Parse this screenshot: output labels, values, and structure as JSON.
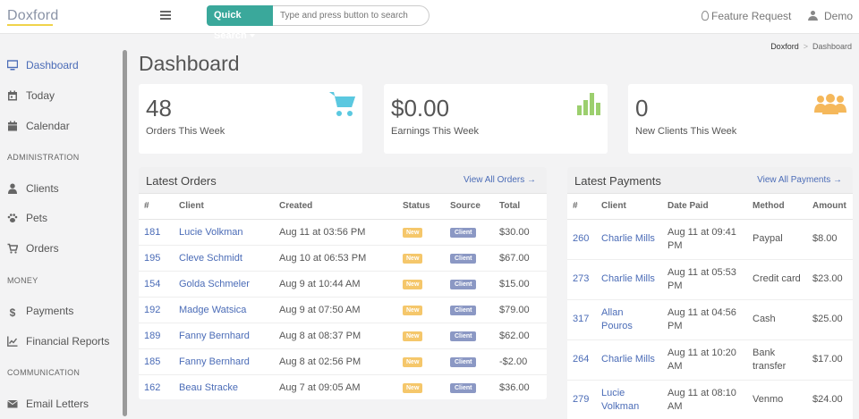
{
  "app": {
    "logo": "Doxford"
  },
  "topbar": {
    "quick_search_label": "Quick Search",
    "search_placeholder": "Type and press button to search",
    "feature_request": "Feature Request",
    "user": "Demo"
  },
  "sidebar": {
    "items": [
      {
        "label": "Dashboard",
        "icon": "monitor-icon"
      },
      {
        "label": "Today",
        "icon": "calendar-day-icon"
      },
      {
        "label": "Calendar",
        "icon": "calendar-icon"
      },
      {
        "label": "Clients",
        "icon": "user-icon"
      },
      {
        "label": "Pets",
        "icon": "paw-icon"
      },
      {
        "label": "Orders",
        "icon": "cart-icon"
      },
      {
        "label": "Payments",
        "icon": "dollar-icon"
      },
      {
        "label": "Financial Reports",
        "icon": "chart-line-icon"
      },
      {
        "label": "Email Letters",
        "icon": "envelope-icon"
      }
    ],
    "sections": [
      "ADMINISTRATION",
      "MONEY",
      "COMMUNICATION"
    ]
  },
  "breadcrumb": {
    "root": "Doxford",
    "separator": ">",
    "current": "Dashboard"
  },
  "page_title": "Dashboard",
  "stats": [
    {
      "value": "48",
      "label": "Orders This Week",
      "icon": "cart-icon",
      "color": "#5bc8e0"
    },
    {
      "value": "$0.00",
      "label": "Earnings This Week",
      "icon": "bar-chart-icon",
      "color": "#9ccf6e"
    },
    {
      "value": "0",
      "label": "New Clients This Week",
      "icon": "users-icon",
      "color": "#f5b85b"
    }
  ],
  "orders": {
    "title": "Latest Orders",
    "link": "View All Orders",
    "columns": [
      "#",
      "Client",
      "Created",
      "Status",
      "Source",
      "Total"
    ],
    "rows": [
      {
        "id": "181",
        "client": "Lucie Volkman",
        "created": "Aug 11 at 03:56 PM",
        "status": "New",
        "source": "Client",
        "total": "$30.00"
      },
      {
        "id": "195",
        "client": "Cleve Schmidt",
        "created": "Aug 10 at 06:53 PM",
        "status": "New",
        "source": "Client",
        "total": "$67.00"
      },
      {
        "id": "154",
        "client": "Golda Schmeler",
        "created": "Aug 9 at 10:44 AM",
        "status": "New",
        "source": "Client",
        "total": "$15.00"
      },
      {
        "id": "192",
        "client": "Madge Watsica",
        "created": "Aug 9 at 07:50 AM",
        "status": "New",
        "source": "Client",
        "total": "$79.00"
      },
      {
        "id": "189",
        "client": "Fanny Bernhard",
        "created": "Aug 8 at 08:37 PM",
        "status": "New",
        "source": "Client",
        "total": "$62.00"
      },
      {
        "id": "185",
        "client": "Fanny Bernhard",
        "created": "Aug 8 at 02:56 PM",
        "status": "New",
        "source": "Client",
        "total": "-$2.00"
      },
      {
        "id": "162",
        "client": "Beau Stracke",
        "created": "Aug 7 at 09:05 AM",
        "status": "New",
        "source": "Client",
        "total": "$36.00"
      }
    ]
  },
  "payments": {
    "title": "Latest Payments",
    "link": "View All Payments",
    "columns": [
      "#",
      "Client",
      "Date Paid",
      "Method",
      "Amount"
    ],
    "rows": [
      {
        "id": "260",
        "client": "Charlie Mills",
        "date": "Aug 11 at 09:41 PM",
        "method": "Paypal",
        "amount": "$8.00"
      },
      {
        "id": "273",
        "client": "Charlie Mills",
        "date": "Aug 11 at 05:53 PM",
        "method": "Credit card",
        "amount": "$23.00"
      },
      {
        "id": "317",
        "client": "Allan Pouros",
        "date": "Aug 11 at 04:56 PM",
        "method": "Cash",
        "amount": "$25.00"
      },
      {
        "id": "264",
        "client": "Charlie Mills",
        "date": "Aug 11 at 10:20 AM",
        "method": "Bank transfer",
        "amount": "$17.00"
      },
      {
        "id": "279",
        "client": "Lucie Volkman",
        "date": "Aug 11 at 08:10 AM",
        "method": "Venmo",
        "amount": "$24.00"
      }
    ]
  },
  "colors": {
    "accent": "#4b6cb7",
    "quick_search": "#3aa89b",
    "badge_new": "#f5c76b",
    "badge_source": "#8b98c4"
  }
}
